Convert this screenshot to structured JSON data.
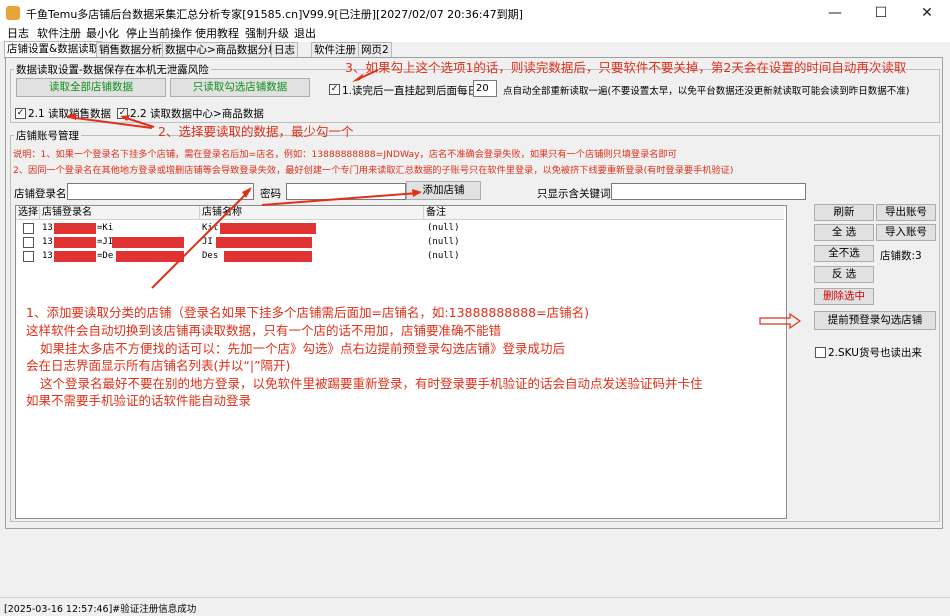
{
  "window": {
    "title": "千鱼Temu多店铺后台数据采集汇总分析专家[91585.cn]V99.9[已注册][2027/02/07 20:36:47到期]",
    "min_glyph": "—",
    "max_glyph": "☐",
    "close_glyph": "✕"
  },
  "menu": [
    "日志",
    "软件注册",
    "最小化",
    "停止当前操作",
    "使用教程",
    "强制升级",
    "退出"
  ],
  "tabs": [
    "店铺设置&数据读取",
    "销售数据分析",
    "数据中心>商品数据分析",
    "日志",
    "软件注册",
    "网页2"
  ],
  "settings": {
    "group_title": "数据读取设置-数据保存在本机无泄露风险",
    "read_all_button": "读取全部店铺数据",
    "read_selected_button": "只读取勾选店铺数据",
    "auto_read_check": "✓",
    "auto_read_label": "1.读完后一直挂起到后面每日",
    "auto_read_hour": "20",
    "auto_read_suffix": "点自动全部重新读取一遍(不要设置太早，以免平台数据还没更新就读取可能会读到昨日数据不准)",
    "opt1_check": "✓",
    "opt1_label": "2.1 读取销售数据",
    "opt2_check": "✓",
    "opt2_label": "2.2 读取数据中心>商品数据"
  },
  "accounts": {
    "group_title": "店铺账号管理",
    "note1": "说明：1、如果一个登录名下挂多个店铺，需在登录名后加=店名，例如：13888888888=JNDWay，店名不准确会登录失败，如果只有一个店铺则只填登录名即可",
    "note2": "2、因同一个登录名在其他地方登录或增删店铺等会导致登录失效，最好创建一个专门用来读取汇总数据的子账号只在软件里登录，以免被挤下线要重新登录(有时登录要手机验证)",
    "login_label": "店铺登录名",
    "password_label": "密码",
    "add_button": "添加店铺",
    "filter_label": "只显示含关键词",
    "columns": [
      "选择",
      "店铺登录名",
      "店铺名称",
      "备注"
    ],
    "rows": [
      {
        "login_prefix": "13",
        "login_suffix": "=Ki",
        "store_prefix": "Kit",
        "note": "(null)"
      },
      {
        "login_prefix": "13",
        "login_suffix": "=JI",
        "store_prefix": "JI",
        "note": "(null)"
      },
      {
        "login_prefix": "13",
        "login_suffix": "=De",
        "store_prefix": "Des",
        "note": "(null)"
      }
    ],
    "refresh_button": "刷新",
    "export_button": "导出账号",
    "select_all_button": "全 选",
    "import_button": "导入账号",
    "deselect_button": "全不选",
    "store_count": "店铺数:3",
    "invert_button": "反 选",
    "delete_button": "删除选中",
    "prelogin_button": "提前预登录勾选店铺",
    "sku_check": "",
    "sku_label": "2.SKU货号也读出来"
  },
  "annotations": {
    "a3": "3、如果勾上这个选项1的话，则读完数据后，只要软件不要关掉，第2天会在设置的时间自动再次读取",
    "a2": "2、选择要读取的数据，最少勾一个",
    "a1_line1": "1、添加要读取分类的店铺（登录名如果下挂多个店铺需后面加=店铺名，如:13888888888=店铺名)",
    "a1_line2": "这样软件会自动切换到该店铺再读取数据，只有一个店的话不用加，店铺要准确不能错",
    "a1_line3": "如果挂太多店不方便找的话可以：先加一个店》勾选》点右边提前预登录勾选店铺》登录成功后",
    "a1_line4": "会在日志界面显示所有店铺名列表(并以“|”隔开)",
    "a1_line5": "这个登录名最好不要在别的地方登录，以免软件里被踢要重新登录，有时登录要手机验证的话会自动点发送验证码并卡住",
    "a1_line6": "如果不需要手机验证的话软件能自动登录"
  },
  "status": "[2025-03-16 12:57:46]#验证注册信息成功",
  "colors": {
    "annotation_red": "#e0301a",
    "mask_red": "#e03333",
    "green_button_text": "#0a8f1a"
  }
}
